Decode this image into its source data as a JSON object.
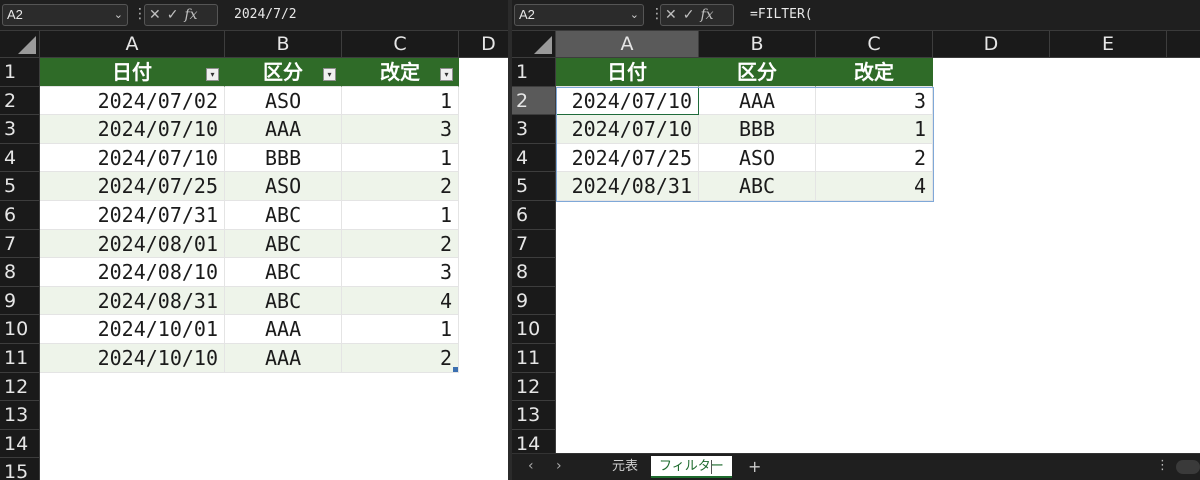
{
  "left_pane": {
    "name_box": "A2",
    "formula": "2024/7/2",
    "columns": [
      "A",
      "B",
      "C",
      "D"
    ],
    "rows": [
      "1",
      "2",
      "3",
      "4",
      "5",
      "6",
      "7",
      "8",
      "9",
      "10",
      "11",
      "12",
      "13",
      "14",
      "15"
    ],
    "table_header": [
      "日付",
      "区分",
      "改定"
    ],
    "table_rows": [
      [
        "2024/07/02",
        "ASO",
        "1"
      ],
      [
        "2024/07/10",
        "AAA",
        "3"
      ],
      [
        "2024/07/10",
        "BBB",
        "1"
      ],
      [
        "2024/07/25",
        "ASO",
        "2"
      ],
      [
        "2024/07/31",
        "ABC",
        "1"
      ],
      [
        "2024/08/01",
        "ABC",
        "2"
      ],
      [
        "2024/08/10",
        "ABC",
        "3"
      ],
      [
        "2024/08/31",
        "ABC",
        "4"
      ],
      [
        "2024/10/01",
        "AAA",
        "1"
      ],
      [
        "2024/10/10",
        "AAA",
        "2"
      ]
    ]
  },
  "right_pane": {
    "name_box": "A2",
    "formula": "=FILTER(",
    "columns": [
      "A",
      "B",
      "C",
      "D",
      "E"
    ],
    "rows": [
      "1",
      "2",
      "3",
      "4",
      "5",
      "6",
      "7",
      "8",
      "9",
      "10",
      "11",
      "12",
      "13",
      "14"
    ],
    "table_header": [
      "日付",
      "区分",
      "改定"
    ],
    "table_rows": [
      [
        "2024/07/10",
        "AAA",
        "3"
      ],
      [
        "2024/07/10",
        "BBB",
        "1"
      ],
      [
        "2024/07/25",
        "ASO",
        "2"
      ],
      [
        "2024/08/31",
        "ABC",
        "4"
      ]
    ],
    "sheet_tabs": [
      "元表",
      "フィルター"
    ],
    "active_tab": "フィルター"
  },
  "icons": {
    "dropdown": "chevron-down-icon",
    "cancel": "x-icon",
    "enter": "checkmark-icon",
    "function": "fx-icon"
  },
  "colors": {
    "header_green": "#2f6b28",
    "band_light": "#eef4ea",
    "chrome_dark": "#1f1f1f"
  }
}
